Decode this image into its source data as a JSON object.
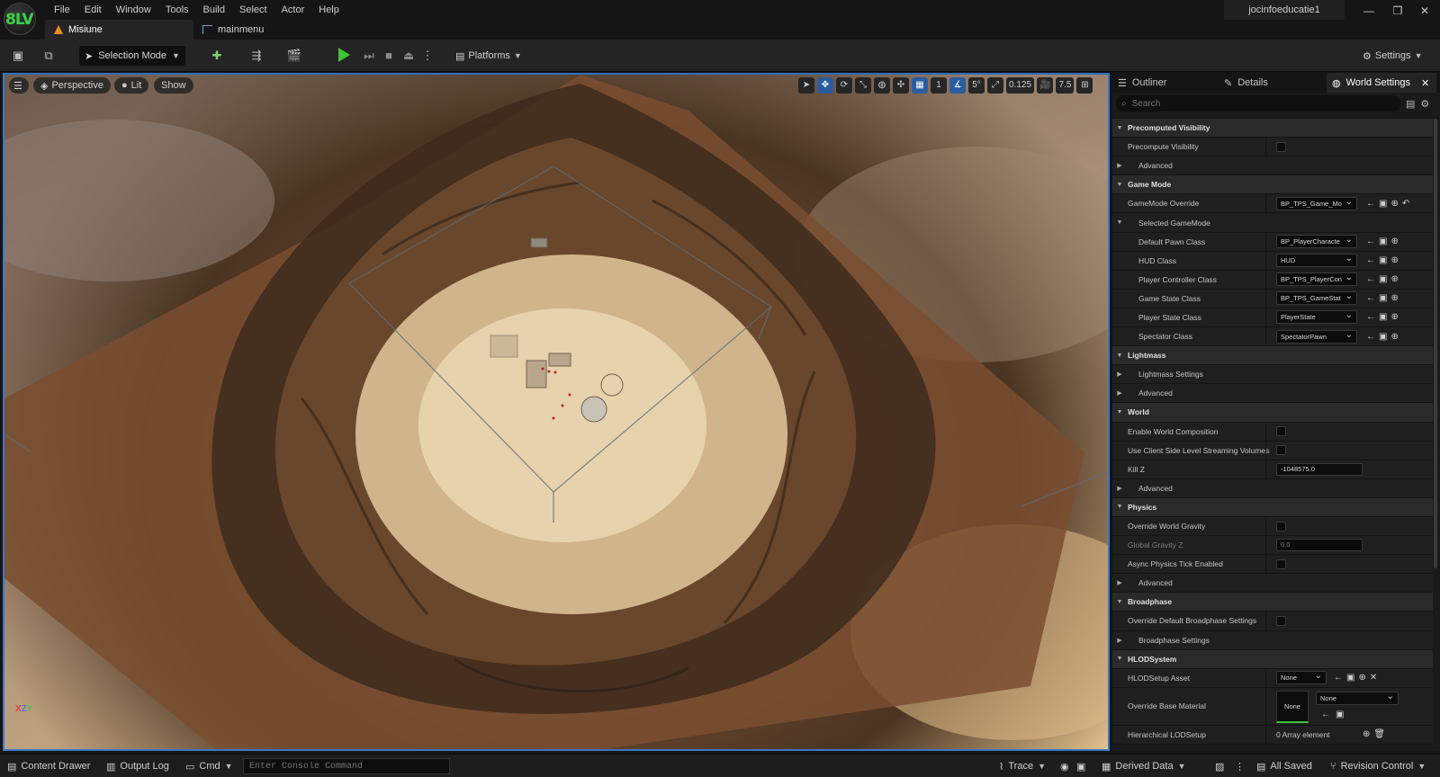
{
  "app": {
    "logo_text": "8LV",
    "user": "jocinfoeducatie1",
    "menu": [
      "File",
      "Edit",
      "Window",
      "Tools",
      "Build",
      "Select",
      "Actor",
      "Help"
    ],
    "tabs": [
      {
        "label": "Misiune",
        "icon": "unreal-level-icon",
        "active": true
      },
      {
        "label": "mainmenu",
        "icon": "blueprint-icon",
        "active": false
      }
    ],
    "window_controls": {
      "minimize": "—",
      "restore": "❐",
      "close": "✕"
    }
  },
  "toolbar": {
    "selection_mode": "Selection Mode",
    "platforms": "Platforms",
    "settings": "Settings",
    "play_color": "#3ec437"
  },
  "viewport": {
    "perspective": "Perspective",
    "lit": "Lit",
    "show": "Show",
    "grid_snap": "1",
    "angle_snap": "5°",
    "scale_snap": "0.125",
    "camera_speed": "7.5",
    "axis": {
      "x": "X",
      "y": "Y",
      "z": "Z"
    }
  },
  "panel": {
    "tabs": [
      {
        "label": "Outliner",
        "icon": "outliner-icon"
      },
      {
        "label": "Details",
        "icon": "pencil-icon"
      },
      {
        "label": "World Settings",
        "icon": "globe-icon",
        "active": true
      }
    ],
    "close": "✕",
    "search_placeholder": "Search",
    "rows": [
      {
        "type": "cat",
        "label": "Precomputed Visibility",
        "open": true
      },
      {
        "type": "prop",
        "label": "Precompute Visibility",
        "control": "check"
      },
      {
        "type": "sub",
        "label": "Advanced"
      },
      {
        "type": "cat",
        "label": "Game Mode",
        "open": true
      },
      {
        "type": "prop",
        "label": "GameMode Override",
        "control": "combo",
        "value": "BP_TPS_Game_Mo",
        "acts": [
          "←",
          "▣",
          "⊕",
          "↶"
        ]
      },
      {
        "type": "sub",
        "label": "Selected GameMode",
        "open": true
      },
      {
        "type": "nest",
        "label": "Default Pawn Class",
        "control": "combo",
        "value": "BP_PlayerCharacte",
        "acts": [
          "←",
          "▣",
          "⊕"
        ]
      },
      {
        "type": "nest",
        "label": "HUD Class",
        "control": "combo",
        "value": "HUD",
        "acts": [
          "←",
          "▣",
          "⊕"
        ]
      },
      {
        "type": "nest",
        "label": "Player Controller Class",
        "control": "combo",
        "value": "BP_TPS_PlayerCon",
        "acts": [
          "←",
          "▣",
          "⊕"
        ]
      },
      {
        "type": "nest",
        "label": "Game State Class",
        "control": "combo",
        "value": "BP_TPS_GameStat",
        "acts": [
          "←",
          "▣",
          "⊕"
        ]
      },
      {
        "type": "nest",
        "label": "Player State Class",
        "control": "combo",
        "value": "PlayerState",
        "acts": [
          "←",
          "▣",
          "⊕"
        ]
      },
      {
        "type": "nest",
        "label": "Spectator Class",
        "control": "combo",
        "value": "SpectatorPawn",
        "acts": [
          "←",
          "▣",
          "⊕"
        ]
      },
      {
        "type": "cat",
        "label": "Lightmass",
        "open": true
      },
      {
        "type": "sub",
        "label": "Lightmass Settings"
      },
      {
        "type": "sub",
        "label": "Advanced"
      },
      {
        "type": "cat",
        "label": "World",
        "open": true
      },
      {
        "type": "prop",
        "label": "Enable World Composition",
        "control": "check"
      },
      {
        "type": "prop",
        "label": "Use Client Side Level Streaming Volumes",
        "control": "check"
      },
      {
        "type": "prop",
        "label": "Kill Z",
        "control": "num",
        "value": "-1048575.0"
      },
      {
        "type": "sub",
        "label": "Advanced"
      },
      {
        "type": "cat",
        "label": "Physics",
        "open": true
      },
      {
        "type": "prop",
        "label": "Override World Gravity",
        "control": "check"
      },
      {
        "type": "prop",
        "label": "Global Gravity Z",
        "control": "num",
        "value": "0.0",
        "dim": true
      },
      {
        "type": "prop",
        "label": "Async Physics Tick Enabled",
        "control": "check"
      },
      {
        "type": "sub",
        "label": "Advanced"
      },
      {
        "type": "cat",
        "label": "Broadphase",
        "open": true
      },
      {
        "type": "prop",
        "label": "Override Default Broadphase Settings",
        "control": "check"
      },
      {
        "type": "sub",
        "label": "Broadphase Settings"
      },
      {
        "type": "cat",
        "label": "HLODSystem",
        "open": true
      },
      {
        "type": "prop",
        "label": "HLODSetup Asset",
        "control": "combo",
        "value": "None",
        "acts": [
          "←",
          "▣",
          "⊕",
          "✕"
        ]
      },
      {
        "type": "mat",
        "label": "Override Base Material",
        "thumb": "None",
        "value": "None"
      },
      {
        "type": "prop",
        "label": "Hierarchical LODSetup",
        "control": "text",
        "value": "0 Array element",
        "acts": [
          "⊕",
          "🗑"
        ]
      }
    ]
  },
  "statusbar": {
    "content_drawer": "Content Drawer",
    "output_log": "Output Log",
    "cmd": "Cmd",
    "console_placeholder": "Enter Console Command",
    "trace": "Trace",
    "derived_data": "Derived Data",
    "all_saved": "All Saved",
    "revision_control": "Revision Control"
  }
}
